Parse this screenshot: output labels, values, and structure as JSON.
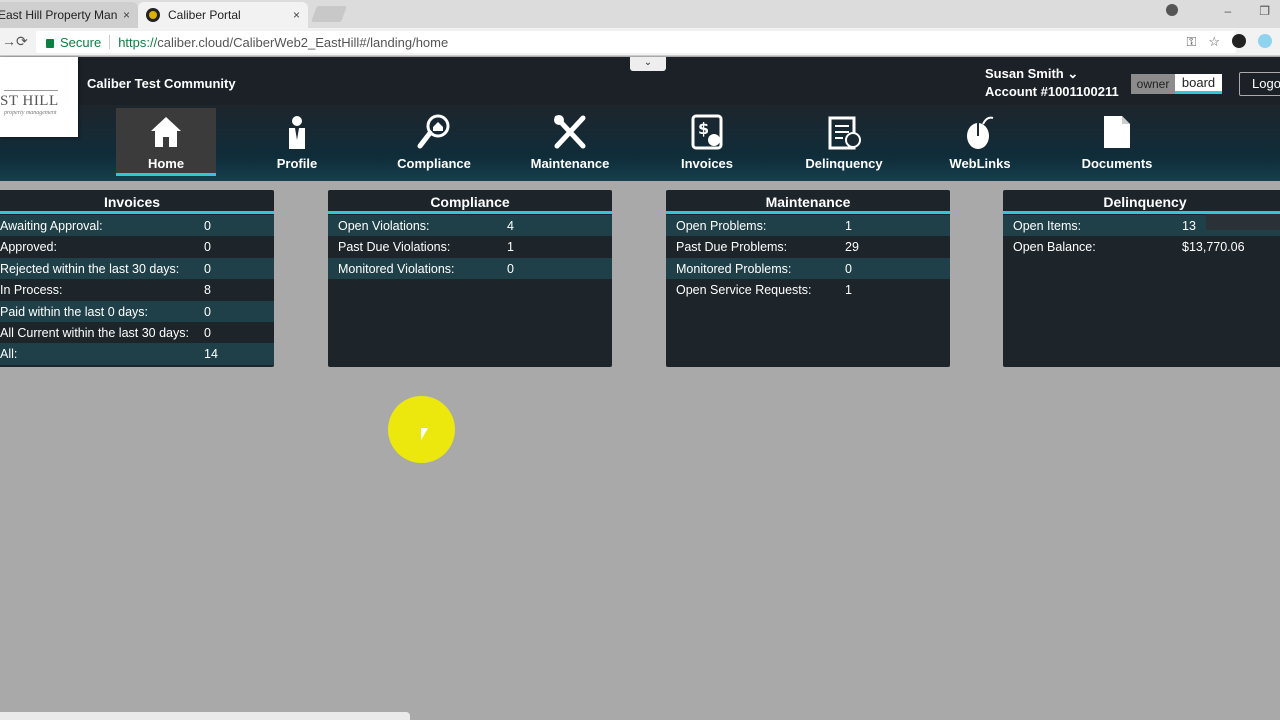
{
  "browser": {
    "tabs": [
      {
        "title": "East Hill Property Manag...",
        "close": "×"
      },
      {
        "title": "Caliber Portal",
        "close": "×"
      }
    ],
    "omnibox": {
      "secure_label": "Secure",
      "url_proto": "https://",
      "url_rest": "caliber.cloud/CaliberWeb2_EastHill#/landing/home"
    },
    "window_controls": [
      "–",
      "❐",
      "✕"
    ]
  },
  "header": {
    "logo_text": "ST HILL",
    "logo_subtext": "property management",
    "community": "Caliber Test Community",
    "dropdown_glyph": "⌄",
    "user_name": "Susan Smith ⌄",
    "account": "Account #1001100211",
    "roles": {
      "owner": "owner",
      "board": "board"
    },
    "logout": "Logo"
  },
  "nav": [
    {
      "label": "Home",
      "icon": "home-icon",
      "active": true
    },
    {
      "label": "Profile",
      "icon": "profile-icon"
    },
    {
      "label": "Compliance",
      "icon": "compliance-icon"
    },
    {
      "label": "Maintenance",
      "icon": "maintenance-icon"
    },
    {
      "label": "Invoices",
      "icon": "invoices-icon"
    },
    {
      "label": "Delinquency",
      "icon": "delinquency-icon"
    },
    {
      "label": "WebLinks",
      "icon": "weblinks-icon"
    },
    {
      "label": "Documents",
      "icon": "documents-icon"
    }
  ],
  "panels": {
    "invoices": {
      "title": "Invoices",
      "rows": [
        {
          "label": "Awaiting Approval:",
          "value": "0"
        },
        {
          "label": "Approved:",
          "value": "0"
        },
        {
          "label": "Rejected within the last 30 days:",
          "value": "0"
        },
        {
          "label": "In Process:",
          "value": "8"
        },
        {
          "label": "Paid within the last 0 days:",
          "value": "0"
        },
        {
          "label": "All Current within the last 30 days:",
          "value": "0"
        },
        {
          "label": "All:",
          "value": "14"
        }
      ]
    },
    "compliance": {
      "title": "Compliance",
      "rows": [
        {
          "label": "Open Violations:",
          "value": "4"
        },
        {
          "label": "Past Due Violations:",
          "value": "1"
        },
        {
          "label": "Monitored Violations:",
          "value": "0"
        }
      ]
    },
    "maintenance": {
      "title": "Maintenance",
      "rows": [
        {
          "label": "Open Problems:",
          "value": "1"
        },
        {
          "label": "Past Due Problems:",
          "value": "29"
        },
        {
          "label": "Monitored Problems:",
          "value": "0"
        },
        {
          "label": "Open Service Requests:",
          "value": "1"
        }
      ]
    },
    "delinquency": {
      "title": "Delinquency",
      "rows": [
        {
          "label": "Open Items:",
          "value": "13"
        },
        {
          "label": "Open Balance:",
          "value": "$13,770.06"
        }
      ]
    }
  },
  "colors": {
    "accent": "#32c6d8",
    "panel_bg": "#1d242a",
    "row_alt": "#1f4049",
    "page_bg": "#a9a9a9"
  }
}
